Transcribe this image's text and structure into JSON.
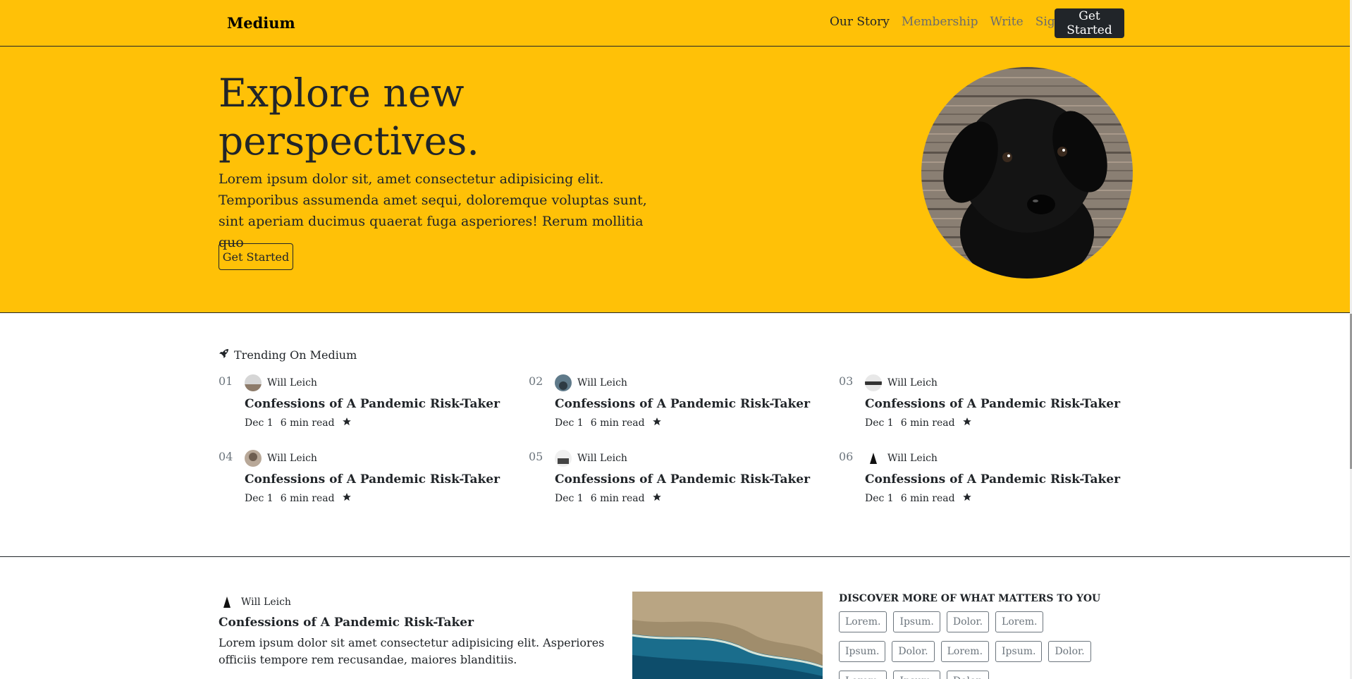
{
  "nav": {
    "brand": "Medium",
    "links": [
      "Our Story",
      "Membership",
      "Write",
      "Sign In"
    ],
    "cta": "Get Started"
  },
  "hero": {
    "title": "Explore new perspectives.",
    "text": "Lorem ipsum dolor sit, amet consectetur adipisicing elit. Temporibus assumenda amet sequi, doloremque voluptas sunt, sint aperiam ducimus quaerat fuga asperiores! Rerum mollitia quo",
    "button": "Get Started"
  },
  "trending": {
    "heading": "Trending On Medium",
    "items": [
      {
        "num": "01",
        "author": "Will Leich",
        "title": "Confessions of A Pandemic Risk-Taker",
        "date": "Dec 1",
        "read": "6 min read"
      },
      {
        "num": "02",
        "author": "Will Leich",
        "title": "Confessions of A Pandemic Risk-Taker",
        "date": "Dec 1",
        "read": "6 min read"
      },
      {
        "num": "03",
        "author": "Will Leich",
        "title": "Confessions of A Pandemic Risk-Taker",
        "date": "Dec 1",
        "read": "6 min read"
      },
      {
        "num": "04",
        "author": "Will Leich",
        "title": "Confessions of A Pandemic Risk-Taker",
        "date": "Dec 1",
        "read": "6 min read"
      },
      {
        "num": "05",
        "author": "Will Leich",
        "title": "Confessions of A Pandemic Risk-Taker",
        "date": "Dec 1",
        "read": "6 min read"
      },
      {
        "num": "06",
        "author": "Will Leich",
        "title": "Confessions of A Pandemic Risk-Taker",
        "date": "Dec 1",
        "read": "6 min read"
      }
    ]
  },
  "post": {
    "author": "Will Leich",
    "title": "Confessions of A Pandemic Risk-Taker",
    "excerpt": "Lorem ipsum dolor sit amet consectetur adipisicing elit. Asperiores officiis tempore rem recusandae, maiores blanditiis."
  },
  "discover": {
    "title": "Discover more of what matters to you",
    "tags": [
      "Lorem.",
      "Ipsum.",
      "Dolor.",
      "Lorem.",
      "Ipsum.",
      "Dolor.",
      "Lorem.",
      "Ipsum.",
      "Dolor.",
      "Lorem.",
      "Ipsum.",
      "Dolor."
    ]
  },
  "colors": {
    "accent": "#ffc107",
    "dark": "#212529"
  }
}
